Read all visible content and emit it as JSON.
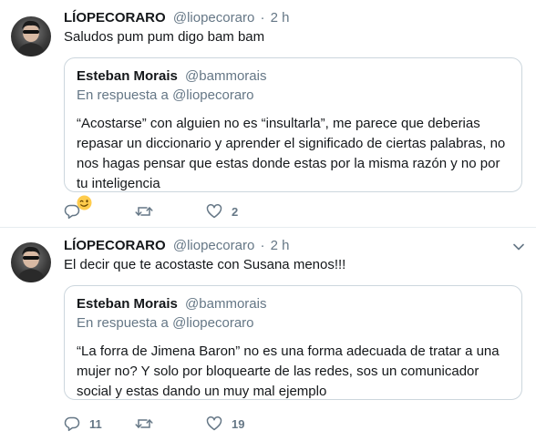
{
  "tweets": [
    {
      "author_name": "LÍOPECORARO",
      "author_handle": "@liopecoraro",
      "separator": "·",
      "time": "2 h",
      "text": "Saludos pum pum digo bam bam",
      "quote": {
        "author_name": "Esteban Morais",
        "author_handle": "@bammorais",
        "reply_context": "En respuesta a @liopecoraro",
        "text": "“Acostarse” con alguien no es “insultarla”, me parece que deberias repasar un diccionario y aprender el significado de ciertas palabras, no nos hagas pensar que estas donde estas por la misma razón y no por tu inteligencia",
        "emoji": "winking-face"
      },
      "replies": "",
      "retweets": "",
      "likes": "2"
    },
    {
      "author_name": "LÍOPECORARO",
      "author_handle": "@liopecoraro",
      "separator": "·",
      "time": "2 h",
      "text": "El decir que te acostaste con Susana menos!!!",
      "quote": {
        "author_name": "Esteban Morais",
        "author_handle": "@bammorais",
        "reply_context": "En respuesta a @liopecoraro",
        "text": "“La forra de Jimena Baron” no es una forma adecuada de tratar a una mujer no? Y solo por bloquearte de las redes, sos un comunicador social y estas dando un muy mal ejemplo"
      },
      "replies": "11",
      "retweets": "",
      "likes": "19"
    }
  ],
  "colors": {
    "text": "#14171a",
    "secondary": "#657786",
    "border": "#e6ecf0",
    "quote_border": "#ccd6dd"
  }
}
